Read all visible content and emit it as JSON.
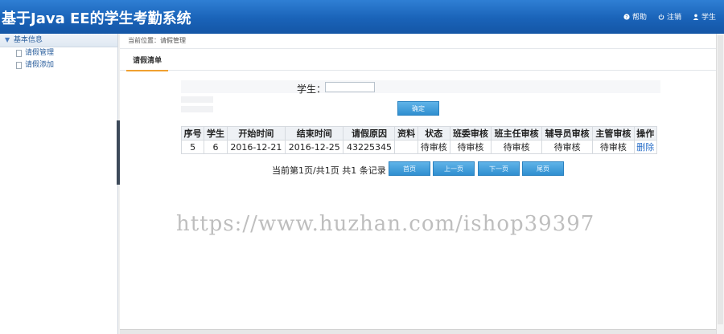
{
  "app": {
    "title": "基于Java EE的学生考勤系统"
  },
  "header": {
    "links": [
      {
        "label": "帮助",
        "icon": "help-icon"
      },
      {
        "label": "注销",
        "icon": "power-icon"
      },
      {
        "label": "学生",
        "icon": "user-icon"
      }
    ]
  },
  "sidebar": {
    "section": "基本信息",
    "items": [
      {
        "label": "请假管理"
      },
      {
        "label": "请假添加"
      }
    ]
  },
  "breadcrumb": "当前位置：请假管理",
  "tab": {
    "label": "请假清单"
  },
  "search": {
    "label": "学生：",
    "value": "",
    "placeholder": ""
  },
  "buttons": {
    "confirm": "确定",
    "first": "首页",
    "prev": "上一页",
    "next": "下一页",
    "last": "尾页"
  },
  "table": {
    "headers": [
      "序号",
      "学生",
      "开始时间",
      "结束时间",
      "请假原因",
      "资料",
      "状态",
      "班委审核",
      "班主任审核",
      "辅导员审核",
      "主管审核",
      "操作"
    ],
    "rows": [
      [
        "5",
        "6",
        "2016-12-21",
        "2016-12-25",
        "43225345",
        "",
        "待审核",
        "待审核",
        "待审核",
        "待审核",
        "待审核",
        "删除"
      ]
    ]
  },
  "pager": {
    "text": "当前第1页/共1页  共1 条记录"
  },
  "watermark": "https://www.huzhan.com/ishop39397",
  "colors": {
    "header": "#1a63b8",
    "button": "#3a9ad8",
    "link": "#2a6fc9"
  }
}
